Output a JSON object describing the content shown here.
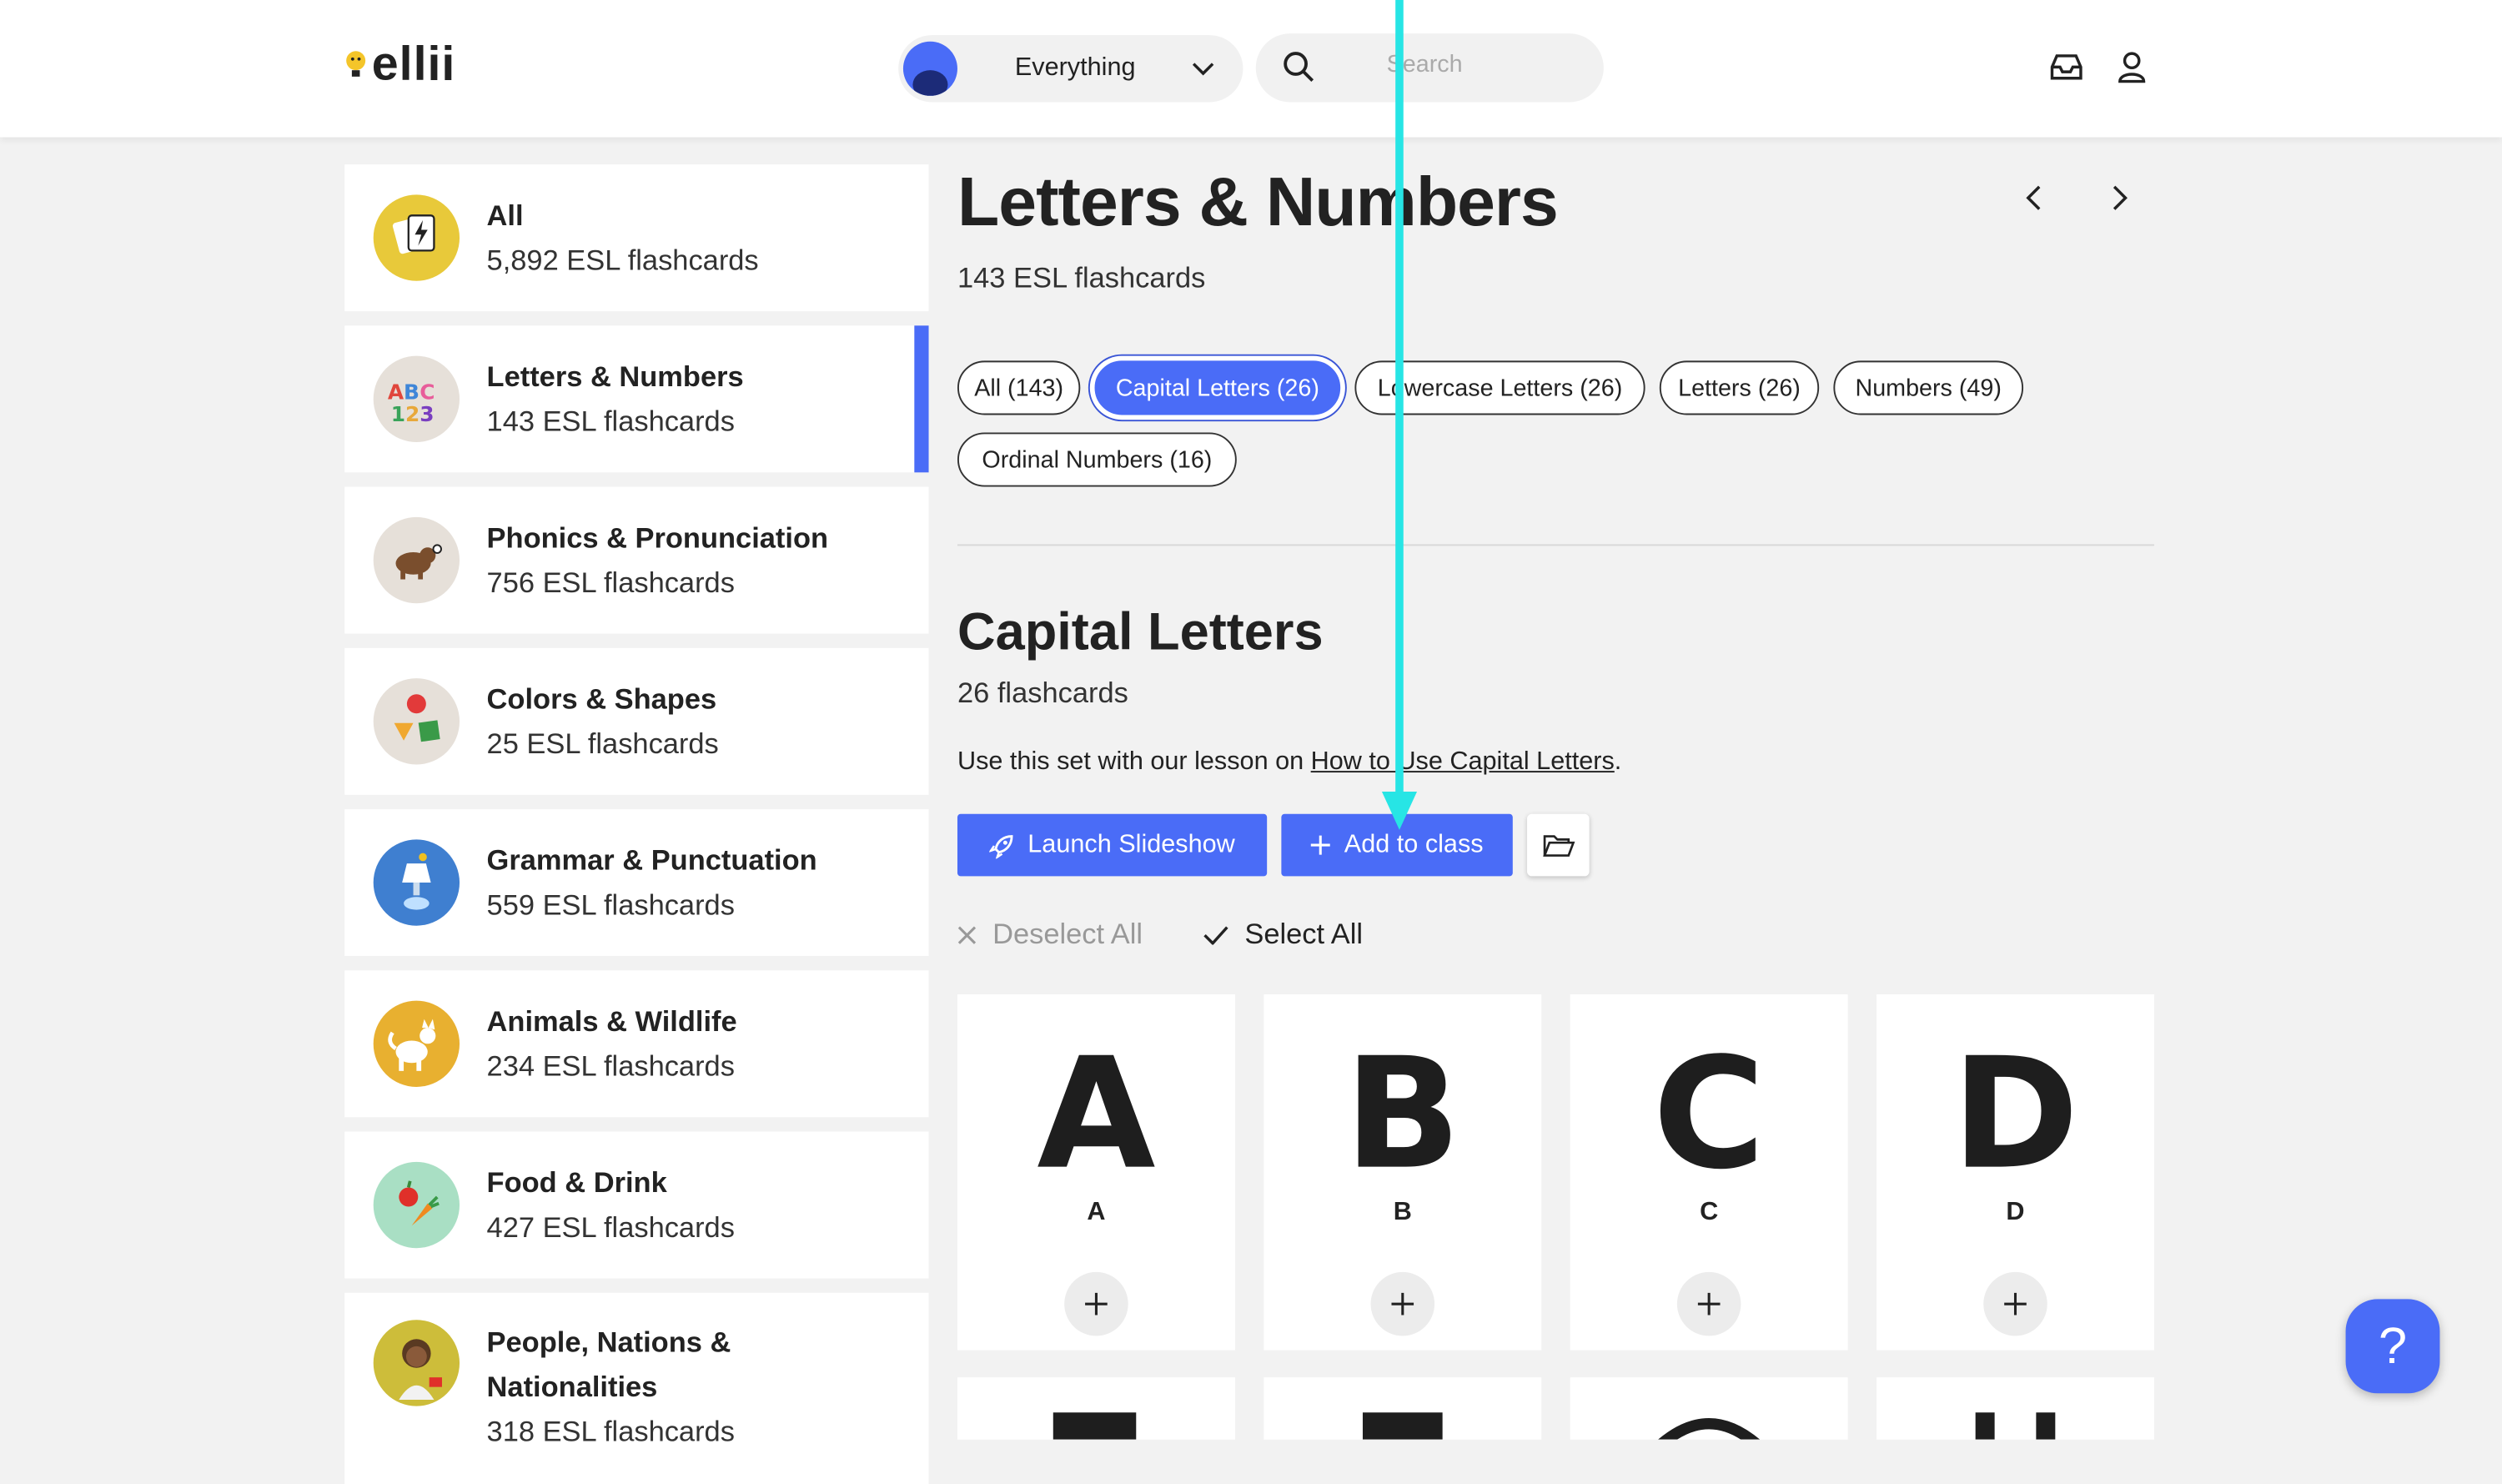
{
  "header": {
    "logo_text": "ellii",
    "scope_label": "Everything",
    "search_placeholder": "Search"
  },
  "sidebar": {
    "items": [
      {
        "name": "All",
        "count": "5,892 ESL flashcards",
        "color": "#e8c93a"
      },
      {
        "name": "Letters & Numbers",
        "count": "143 ESL flashcards",
        "color": "#e6e0d9"
      },
      {
        "name": "Phonics & Pronunciation",
        "count": "756 ESL flashcards",
        "color": "#e6e0d9"
      },
      {
        "name": "Colors & Shapes",
        "count": "25 ESL flashcards",
        "color": "#e6e0d9"
      },
      {
        "name": "Grammar & Punctuation",
        "count": "559 ESL flashcards",
        "color": "#3f7fd0"
      },
      {
        "name": "Animals & Wildlife",
        "count": "234 ESL flashcards",
        "color": "#e8b030"
      },
      {
        "name": "Food & Drink",
        "count": "427 ESL flashcards",
        "color": "#a9dfc4"
      },
      {
        "name": "People, Nations &",
        "name2": "Nationalities",
        "count": "318 ESL flashcards",
        "color": "#cdbd3a"
      }
    ]
  },
  "main": {
    "title": "Letters & Numbers",
    "subtitle": "143 ESL flashcards",
    "filters": [
      "All (143)",
      "Capital Letters (26)",
      "Lowercase Letters (26)",
      "Letters (26)",
      "Numbers (49)",
      "Ordinal Numbers (16)"
    ],
    "section_title": "Capital Letters",
    "section_count": "26 flashcards",
    "lesson_prefix": "Use this set with our lesson on ",
    "lesson_link": "How to Use Capital Letters",
    "lesson_suffix": ".",
    "launch_label": "Launch Slideshow",
    "add_label": "Add to class",
    "deselect_label": "Deselect All",
    "select_label": "Select All",
    "cards": [
      {
        "big": "A",
        "label": "A"
      },
      {
        "big": "B",
        "label": "B"
      },
      {
        "big": "C",
        "label": "C"
      },
      {
        "big": "D",
        "label": "D"
      }
    ],
    "help_label": "?",
    "accent_color": "#4a6cf7",
    "annotation_color": "#27e5e5"
  }
}
